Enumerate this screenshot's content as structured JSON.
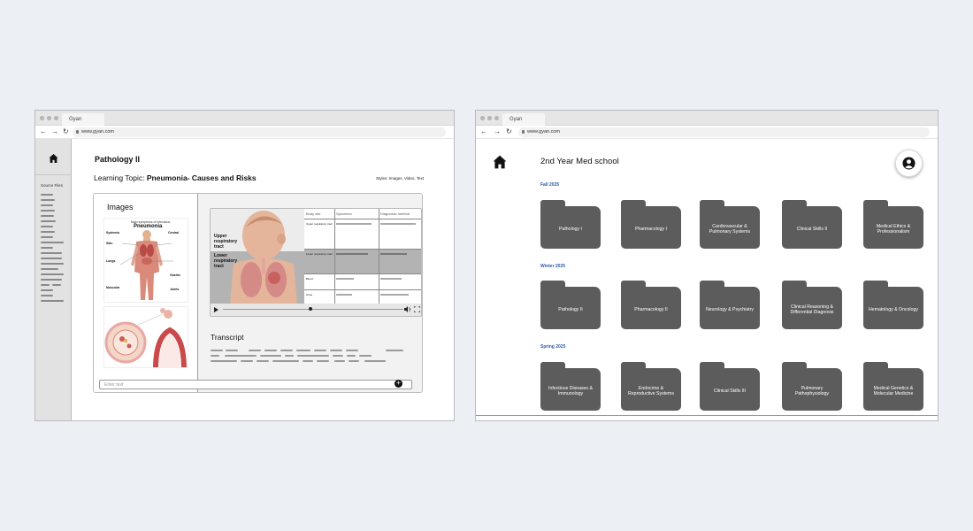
{
  "left_window": {
    "tab_title": "Gyan",
    "url": "www.gyan.com",
    "sidebar": {
      "label": "Source Files"
    },
    "page_title": "Pathology II",
    "topic_prefix": "Learning Topic:",
    "topic_name": "Pneumonia- Causes and Risks",
    "styles": "Styles: Images, Video, Text",
    "images_heading": "Images",
    "infographic": {
      "subtitle": "Main symptoms of infectious",
      "title": "Pneumonia",
      "labels": [
        "Systemic",
        "Central",
        "Skin",
        "Lungs",
        "Muscular",
        "Gastric",
        "Joints"
      ]
    },
    "video_table": {
      "headers": [
        "Body site",
        "Specimen",
        "Diagnostic method"
      ],
      "rows": [
        "Upper respiratory tract",
        "Lower respiratory tract",
        "Blood",
        "Urine"
      ],
      "overlay_upper": "Upper respiratory tract",
      "overlay_lower": "Lower respiratory tract"
    },
    "transcript_heading": "Transcript",
    "input_placeholder": "Enter text",
    "send_symbol": "+"
  },
  "right_window": {
    "tab_title": "Gyan",
    "url": "www.gyan.com",
    "page_title": "2nd Year Med school",
    "semesters": [
      {
        "name": "Fall 2025",
        "courses": [
          "Pathology I",
          "Pharmacology I",
          "Cardiovascular & Pulmonary Systems",
          "Clinical Skills II",
          "Medical Ethics & Professionalism"
        ]
      },
      {
        "name": "Winter 2025",
        "courses": [
          "Pathology II",
          "Pharmacology II",
          "Neurology & Psychiatry",
          "Clinical Reasoning & Differential Diagnosis",
          "Hematology & Oncology"
        ]
      },
      {
        "name": "Spring 2025",
        "courses": [
          "Infectious Diseases & Immunology",
          "Endocrine & Reproductive Systems",
          "Clinical Skills III",
          "Pulmonary Pathophysiology",
          "Medical Genetics & Molecular Medicine"
        ]
      }
    ]
  },
  "icons": [
    "home-icon",
    "back-arrow-icon",
    "forward-arrow-icon",
    "reload-icon",
    "lock-icon",
    "play-icon",
    "volume-icon",
    "fullscreen-icon",
    "add-icon",
    "profile-icon",
    "folder-icon"
  ],
  "colors": {
    "folder": "#5c5c5c",
    "semester_label": "#2b5aa6",
    "page_background": "#eceff3"
  }
}
